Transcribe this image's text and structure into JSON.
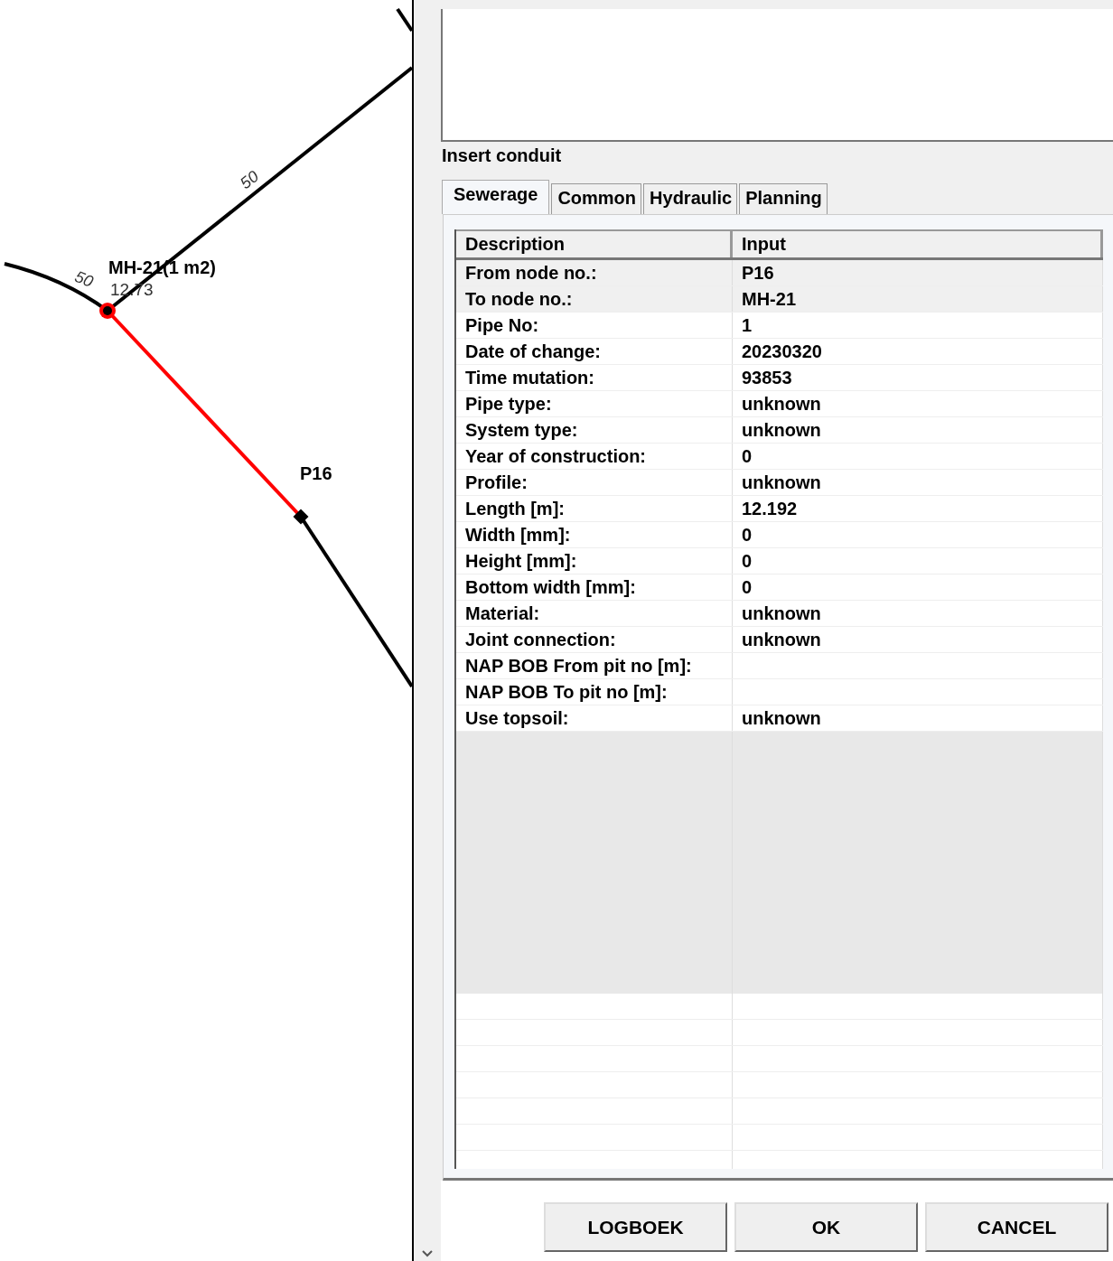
{
  "map": {
    "nodes": [
      {
        "name": "MH-21(1 m2)",
        "value": "12.73",
        "selected": true
      },
      {
        "name": "P16",
        "selected": false
      }
    ],
    "pipe_labels": [
      "50",
      "50"
    ]
  },
  "dialog": {
    "title": "Insert conduit",
    "tabs": [
      {
        "label": "Sewerage",
        "selected": true
      },
      {
        "label": "Common",
        "selected": false
      },
      {
        "label": "Hydraulic",
        "selected": false
      },
      {
        "label": "Planning",
        "selected": false
      }
    ],
    "table": {
      "columns": [
        "Description",
        "Input"
      ],
      "rows": [
        {
          "description": "From node no.:",
          "input": "P16",
          "readonly": true
        },
        {
          "description": "To node no.:",
          "input": "MH-21",
          "readonly": true
        },
        {
          "description": "Pipe No:",
          "input": "1",
          "readonly": false
        },
        {
          "description": "Date of change:",
          "input": "20230320",
          "readonly": false
        },
        {
          "description": "Time mutation:",
          "input": "93853",
          "readonly": false
        },
        {
          "description": "Pipe type:",
          "input": "unknown",
          "readonly": false
        },
        {
          "description": "System type:",
          "input": "unknown",
          "readonly": false
        },
        {
          "description": "Year of construction:",
          "input": "0",
          "readonly": false
        },
        {
          "description": "Profile:",
          "input": "unknown",
          "readonly": false
        },
        {
          "description": "Length [m]:",
          "input": "12.192",
          "readonly": false
        },
        {
          "description": "Width [mm]:",
          "input": "0",
          "readonly": false
        },
        {
          "description": "Height [mm]:",
          "input": "0",
          "readonly": false
        },
        {
          "description": "Bottom width [mm]:",
          "input": "0",
          "readonly": false
        },
        {
          "description": "Material:",
          "input": "unknown",
          "readonly": false
        },
        {
          "description": "Joint connection:",
          "input": "unknown",
          "readonly": false
        },
        {
          "description": "NAP BOB From pit no [m]:",
          "readonly": false
        },
        {
          "description": "NAP BOB To pit no [m]:",
          "readonly": false
        },
        {
          "description": "Use topsoil:",
          "input": "unknown",
          "readonly": false
        }
      ]
    },
    "buttons": [
      "LOGBOEK",
      "OK",
      "CANCEL"
    ]
  }
}
